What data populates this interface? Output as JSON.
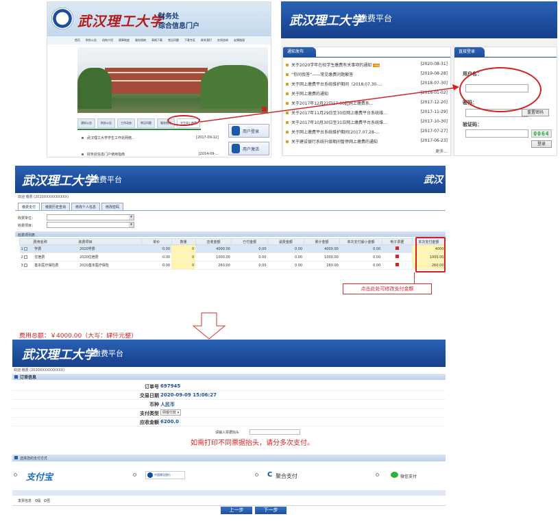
{
  "portal": {
    "brand": "武汉理工大学",
    "title_line1": "财务处",
    "title_line2": "综合信息门户",
    "nav": [
      "首页",
      "财务公告",
      "机构介绍",
      "规章制度",
      "服务指南",
      "表格下载",
      "常见问题",
      "下载专区",
      "联系我们",
      "在线咨询",
      "友情链接"
    ],
    "tabs": [
      "通知公告",
      "财务公告",
      "工作动态",
      "常见问题",
      "服务指南",
      "学生网上缴费"
    ],
    "list": [
      {
        "text": "武汉理工大学学生工作处网络...",
        "date": "[2017-09-12]"
      },
      {
        "text": "财务处信息门户使用指南",
        "date": "[2014-09-..."
      }
    ],
    "btn_login": "用户登录",
    "btn_activate": "用户激活"
  },
  "platform": {
    "brand": "武汉理工大学",
    "title": "缴费平台",
    "notice_title": "通知发布",
    "notices": [
      {
        "text": "关于2020学年在校学生缴费有关事项的通知",
        "date": "[2020-08-31]",
        "new": true
      },
      {
        "text": "“你问我答”——常见缴费问题解答",
        "date": "[2019-08-28]",
        "new": false
      },
      {
        "text": "关于网上缴费平台系统维护期间（2018.07.30-...",
        "date": "[2018-07-30]",
        "new": false
      },
      {
        "text": "关于网上缴费的通知",
        "date": "[2018-01-02]",
        "new": false
      },
      {
        "text": "关于2017年12月22日17:00起网上缴费系...",
        "date": "[2017-12-20]",
        "new": false
      },
      {
        "text": "关于2017年11月29日至30日网上缴费平台系统维...",
        "date": "[2017-11-29]",
        "new": false
      },
      {
        "text": "关于2017年10月30日至31日网上缴费平台系统维...",
        "date": "[2017-10-30]",
        "new": false
      },
      {
        "text": "关于网上缴费平台系统维护期间(2017.07.28-...",
        "date": "[2017-07-27]",
        "new": false
      },
      {
        "text": "关于建设银行系统升级期间暂停网上缴费的通知",
        "date": "[2017-06-23]",
        "new": false
      }
    ],
    "more": "更多...",
    "new_badge": "new",
    "login_title": "直接登录",
    "username_label": "用户名：",
    "password_label": "密码：",
    "reset_pwd": "重置密码",
    "captcha_label": "验证码：",
    "captcha_code": "0064",
    "login_btn": "登录"
  },
  "pay": {
    "brand": "武汉理工大学",
    "title": "缴费平台",
    "user_line": "欢迎 缴费 (2020XXXXXXXXXX)",
    "tabs": [
      "缴费支付",
      "缴费历史查询",
      "修改个人信息",
      "修改密码"
    ],
    "filter1_label": "收费单位：",
    "filter2_label": "收费项目：",
    "list_title": "收费项列表",
    "headers": [
      "",
      "费用名称",
      "收费项目",
      "单价",
      "数量",
      "应收金额",
      "已付金额",
      "退费金额",
      "累计金额",
      "单次支付最小金额",
      "电子票据",
      "本次支付金额"
    ],
    "rows": [
      {
        "n": "1",
        "name": "学费",
        "item": "2020学费",
        "price": "0.00",
        "qty": "0",
        "due": "4000.00",
        "paid": "0.00",
        "refund": "0.00",
        "total": "4000.00",
        "min": "0.00",
        "amt": "4000"
      },
      {
        "n": "2",
        "name": "住宿费",
        "item": "2020住宿费",
        "price": "0.00",
        "qty": "0",
        "due": "1000.00",
        "paid": "0.00",
        "refund": "0.00",
        "total": "1000.00",
        "min": "0.00",
        "amt": "1000.00"
      },
      {
        "n": "3",
        "name": "基本医疗保险费",
        "item": "2020基本医疗保险",
        "price": "0.00",
        "qty": "0",
        "due": "260.00",
        "paid": "0.00",
        "refund": "0.00",
        "total": "260.00",
        "min": "0.00",
        "amt": "260.00"
      }
    ],
    "callout": "点击此处可修改支付金额",
    "partial": "费用总额：￥4000.00（大写：肆仟元整）"
  },
  "order": {
    "brand": "武汉理工大学",
    "title": "缴费平台",
    "user_line": "欢迎 缴费 (2020XXXXXXXXXX)",
    "section": "订单信息",
    "fields": [
      {
        "label": "订单号",
        "value": "697945"
      },
      {
        "label": "交易日期",
        "value": "2020-09-09 15:06:27"
      },
      {
        "label": "币种",
        "value": "人民币"
      },
      {
        "label": "支付类型",
        "value": "网银付款"
      },
      {
        "label": "应收金额",
        "value": "6200.0"
      }
    ],
    "invoice_label": "请输入票据抬头",
    "warning": "如需打印不同票据抬头，请分多次支付。",
    "pay_section": "选择您的支付方式",
    "methods": [
      "支付宝",
      "中国建设银行",
      "聚合支付",
      "微信支付"
    ],
    "invoice_opt": "发票信息",
    "invoice_yes": "是",
    "invoice_no": "否",
    "btn_prev": "上一步",
    "btn_next": "下一步"
  }
}
